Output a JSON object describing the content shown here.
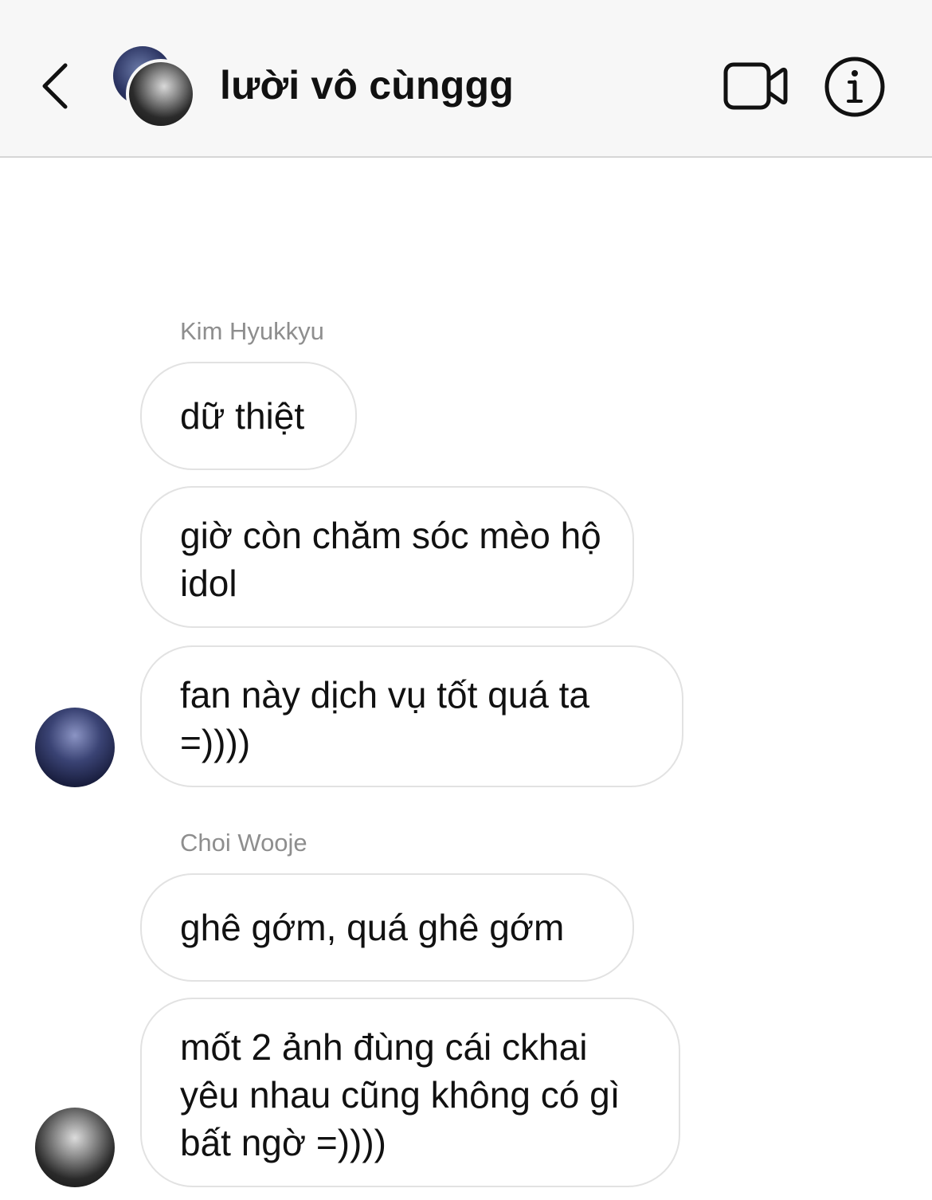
{
  "header": {
    "title": "lười vô cùnggg",
    "back_icon": "chevron-left-icon",
    "video_icon": "video-camera-icon",
    "info_icon": "info-icon"
  },
  "messages": [
    {
      "sender": "Kim Hyukkyu",
      "bubbles": [
        "dữ thiệt",
        "giờ còn chăm sóc mèo hộ idol",
        "fan này dịch vụ tốt quá ta =))))"
      ]
    },
    {
      "sender": "Choi Wooje",
      "bubbles": [
        "ghê gớm, quá ghê gớm",
        "mốt 2 ảnh đùng cái ckhai yêu nhau cũng không có gì bất ngờ =))))"
      ]
    }
  ],
  "colors": {
    "header_bg": "#f7f7f7",
    "bubble_border": "#e2e2e2",
    "sender_name": "#8e8e8e"
  }
}
